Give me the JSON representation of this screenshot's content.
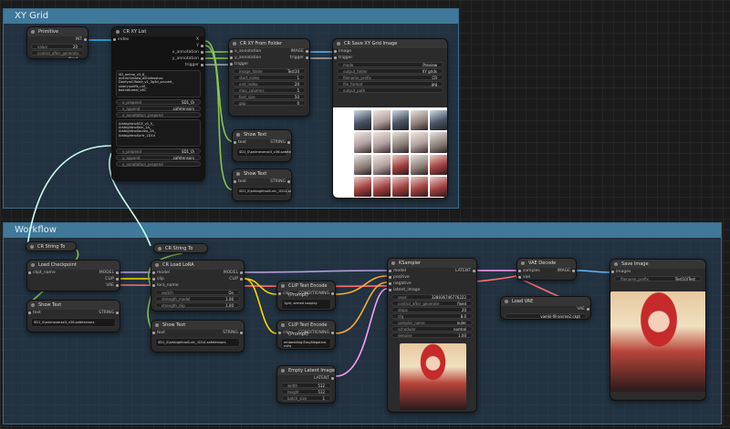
{
  "groups": {
    "xy": "XY Grid",
    "workflow": "Workflow"
  },
  "primitive": {
    "title": "Primitive",
    "output": "INT",
    "value_label": "value",
    "value": "20",
    "control_label": "control_after_generate",
    "control": "fixed"
  },
  "xylist": {
    "title": "CR XY List",
    "input": "index",
    "outputs": [
      "X",
      "Y",
      "x_annotation",
      "y_annotation",
      "trigger"
    ],
    "list1": "SD_anime_v3_6_\nacitrinSmilaw_diltinfesshac\nDanfyroClfalee_v1_3g3d_pruned_\nsixeryuuiiffs_rv0_\nbaknatureel_v61",
    "x_prepend_label": "x_prepend",
    "x_prepend": "SD1_0\\",
    "x_append_label": "x_append",
    "x_append": ".safetensors",
    "x_annotation_prepend_label": "x_annotation_prepend",
    "list2": "ArkbightnoSCE_v1_0_\nArkbightnoSkin_1A_\nArkbightnoSaureo_2A_\nArkbightnoSurtr_1D14",
    "y_prepend_label": "y_prepend",
    "y_prepend": "SD1_0\\",
    "y_append_label": "y_append",
    "y_append": ".safetensors",
    "y_annotation_prepend_label": "y_annotation_prepend"
  },
  "xyfolder": {
    "title": "CR XY From Folder",
    "inputs": [
      "x_annotation",
      "y_annotation",
      "trigger"
    ],
    "outputs": [
      "IMAGE",
      "trigger"
    ],
    "widgets": [
      [
        "image_folder",
        "Test10"
      ],
      [
        "start_index",
        "1"
      ],
      [
        "end_index",
        "20"
      ],
      [
        "max_columns",
        "5"
      ],
      [
        "font_size",
        "50"
      ],
      [
        "gap",
        "0"
      ]
    ]
  },
  "savegrid": {
    "title": "CR Save XY Grid Image",
    "inputs": [
      "image",
      "trigger"
    ],
    "widgets": [
      [
        "mode",
        "Preview"
      ],
      [
        "output_folder",
        "XY grids"
      ],
      [
        "filename_prefix",
        "CR"
      ],
      [
        "file_format",
        "jpg"
      ],
      [
        "output_path",
        ""
      ]
    ]
  },
  "showtext1": {
    "title": "Show Text",
    "input": "text",
    "output": "STRING",
    "content": "SD1_0\\animeverse3_v36.safetensors"
  },
  "showtext2": {
    "title": "Show Text",
    "input": "text",
    "output": "STRING",
    "content": "SD1_0\\arkbightnoSurtr_1D14.safetensors"
  },
  "combo1": {
    "title": "CR String To Combo"
  },
  "combo2": {
    "title": "CR String To Combo"
  },
  "checkpoint": {
    "title": "Load Checkpoint",
    "input": "ckpt_name",
    "outputs": [
      "MODEL",
      "CLIP",
      "VAE"
    ]
  },
  "showtext3": {
    "title": "Show Text",
    "input": "text",
    "output": "STRING",
    "content": "SD1_0\\animeverse3_v36.safetensors"
  },
  "lora": {
    "title": "CR Load LoRA",
    "inputs": [
      "model",
      "clip",
      "lora_name"
    ],
    "outputs": [
      "MODEL",
      "CLIP"
    ],
    "widgets": [
      [
        "switch",
        "On"
      ],
      [
        "strength_model",
        "1.00"
      ],
      [
        "strength_clip",
        "1.00"
      ]
    ]
  },
  "showtext4": {
    "title": "Show Text",
    "input": "text",
    "output": "STRING",
    "content": "SD1_0\\arkbightnoSurtr_1D14.safetensors"
  },
  "clip1": {
    "title": "CLIP Text Encode (Prompt)",
    "input": "clip",
    "output": "CONDITIONING",
    "text": "1girl, armed cosplay"
  },
  "clip2": {
    "title": "CLIP Text Encode (Prompt)",
    "input": "clip",
    "output": "CONDITIONING",
    "text": "embedding:EasyNegative,\nnsfw"
  },
  "latent": {
    "title": "Empty Latent Image",
    "output": "LATENT",
    "widgets": [
      [
        "width",
        "512"
      ],
      [
        "height",
        "512"
      ],
      [
        "batch_size",
        "1"
      ]
    ]
  },
  "ksampler": {
    "title": "KSampler",
    "inputs": [
      "model",
      "positive",
      "negative",
      "latent_image"
    ],
    "output": "LATENT",
    "widgets": [
      [
        "seed",
        "328036746776222"
      ],
      [
        "control_after_generate",
        "fixed"
      ],
      [
        "steps",
        "20"
      ],
      [
        "cfg",
        "8.0"
      ],
      [
        "sampler_name",
        "euler"
      ],
      [
        "scheduler",
        "normal"
      ],
      [
        "denoise",
        "1.00"
      ]
    ]
  },
  "vaedecode": {
    "title": "VAE Decode",
    "inputs": [
      "samples",
      "vae"
    ],
    "output": "IMAGE"
  },
  "loadvae": {
    "title": "Load VAE",
    "output": "VAE",
    "vae_name": "vae\\kl-f8-anime2.ckpt"
  },
  "saveimage": {
    "title": "Save Image",
    "input": "images",
    "prefix_label": "filename_prefix",
    "prefix": "Test10/Test"
  },
  "colors": {
    "model": "#b39ddb",
    "clip": "#ffd500",
    "cond": "#ffa931",
    "latent": "#ff9cf9",
    "vae": "#ff6e6e",
    "image": "#64b5f6",
    "string": "#8bc34a",
    "int": "#29b6f6"
  }
}
